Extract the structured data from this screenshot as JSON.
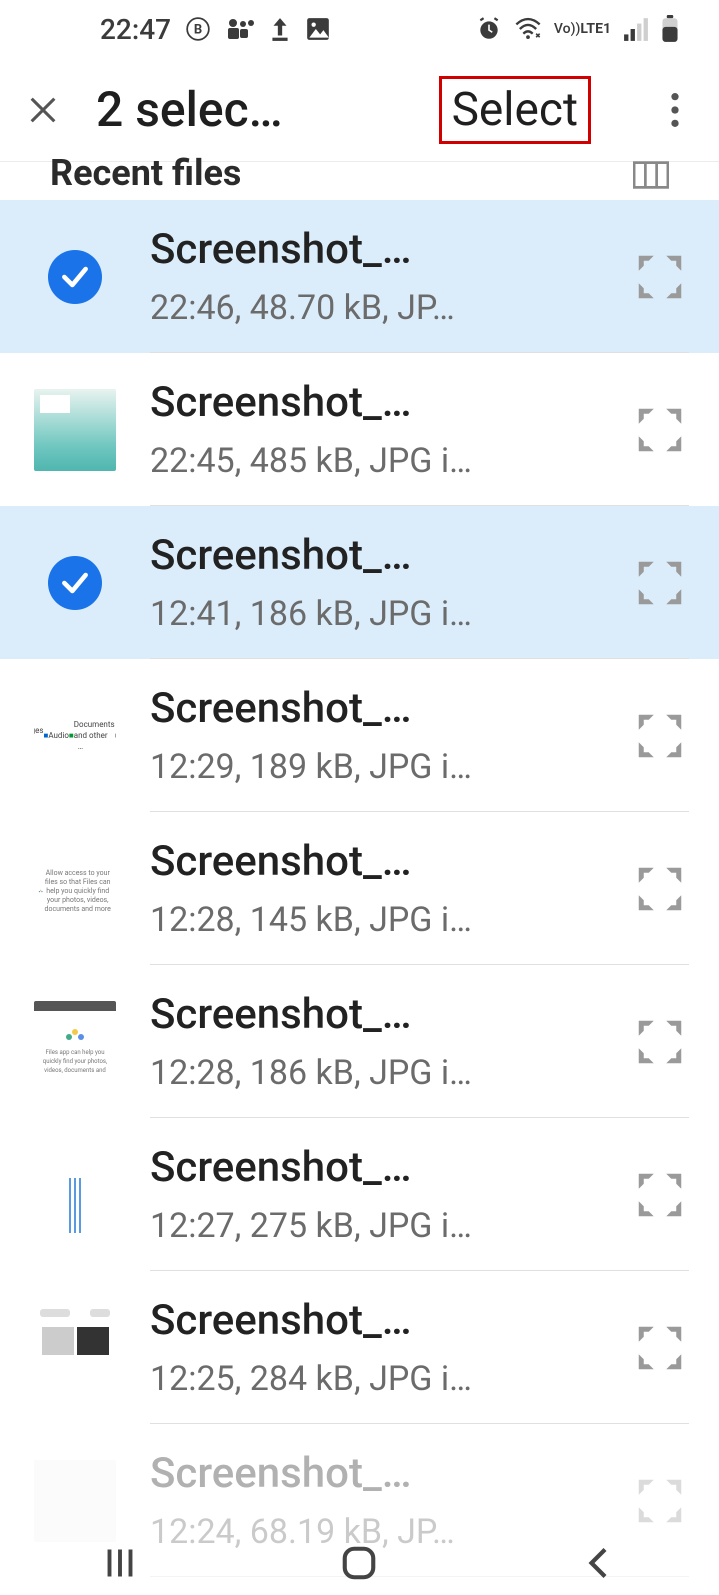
{
  "status": {
    "time": "22:47",
    "network_label": "LTE1",
    "vo_label": "Vo))"
  },
  "appbar": {
    "title": "2 selec…",
    "select_label": "Select"
  },
  "section": {
    "title": "Recent files"
  },
  "files": [
    {
      "selected": true,
      "name": "Screenshot_…",
      "meta": "22:46, 48.70 kB, JP…",
      "thumb": "check"
    },
    {
      "selected": false,
      "name": "Screenshot_…",
      "meta": "22:45, 485 kB, JPG i…",
      "thumb": "pool"
    },
    {
      "selected": true,
      "name": "Screenshot_…",
      "meta": "12:41, 186 kB, JPG i…",
      "thumb": "check"
    },
    {
      "selected": false,
      "name": "Screenshot_…",
      "meta": "12:29, 189 kB, JPG i…",
      "thumb": "list"
    },
    {
      "selected": false,
      "name": "Screenshot_…",
      "meta": "12:28, 145 kB, JPG i…",
      "thumb": "card"
    },
    {
      "selected": false,
      "name": "Screenshot_…",
      "meta": "12:28, 186 kB, JPG i…",
      "thumb": "bar"
    },
    {
      "selected": false,
      "name": "Screenshot_…",
      "meta": "12:27, 275 kB, JPG i…",
      "thumb": "tiles"
    },
    {
      "selected": false,
      "name": "Screenshot_…",
      "meta": "12:25, 284 kB, JPG i…",
      "thumb": "gallery"
    },
    {
      "selected": false,
      "name": "Screenshot_…",
      "meta": "12:24, 68.19 kB, JP…",
      "thumb": "blank",
      "faded": true
    }
  ]
}
